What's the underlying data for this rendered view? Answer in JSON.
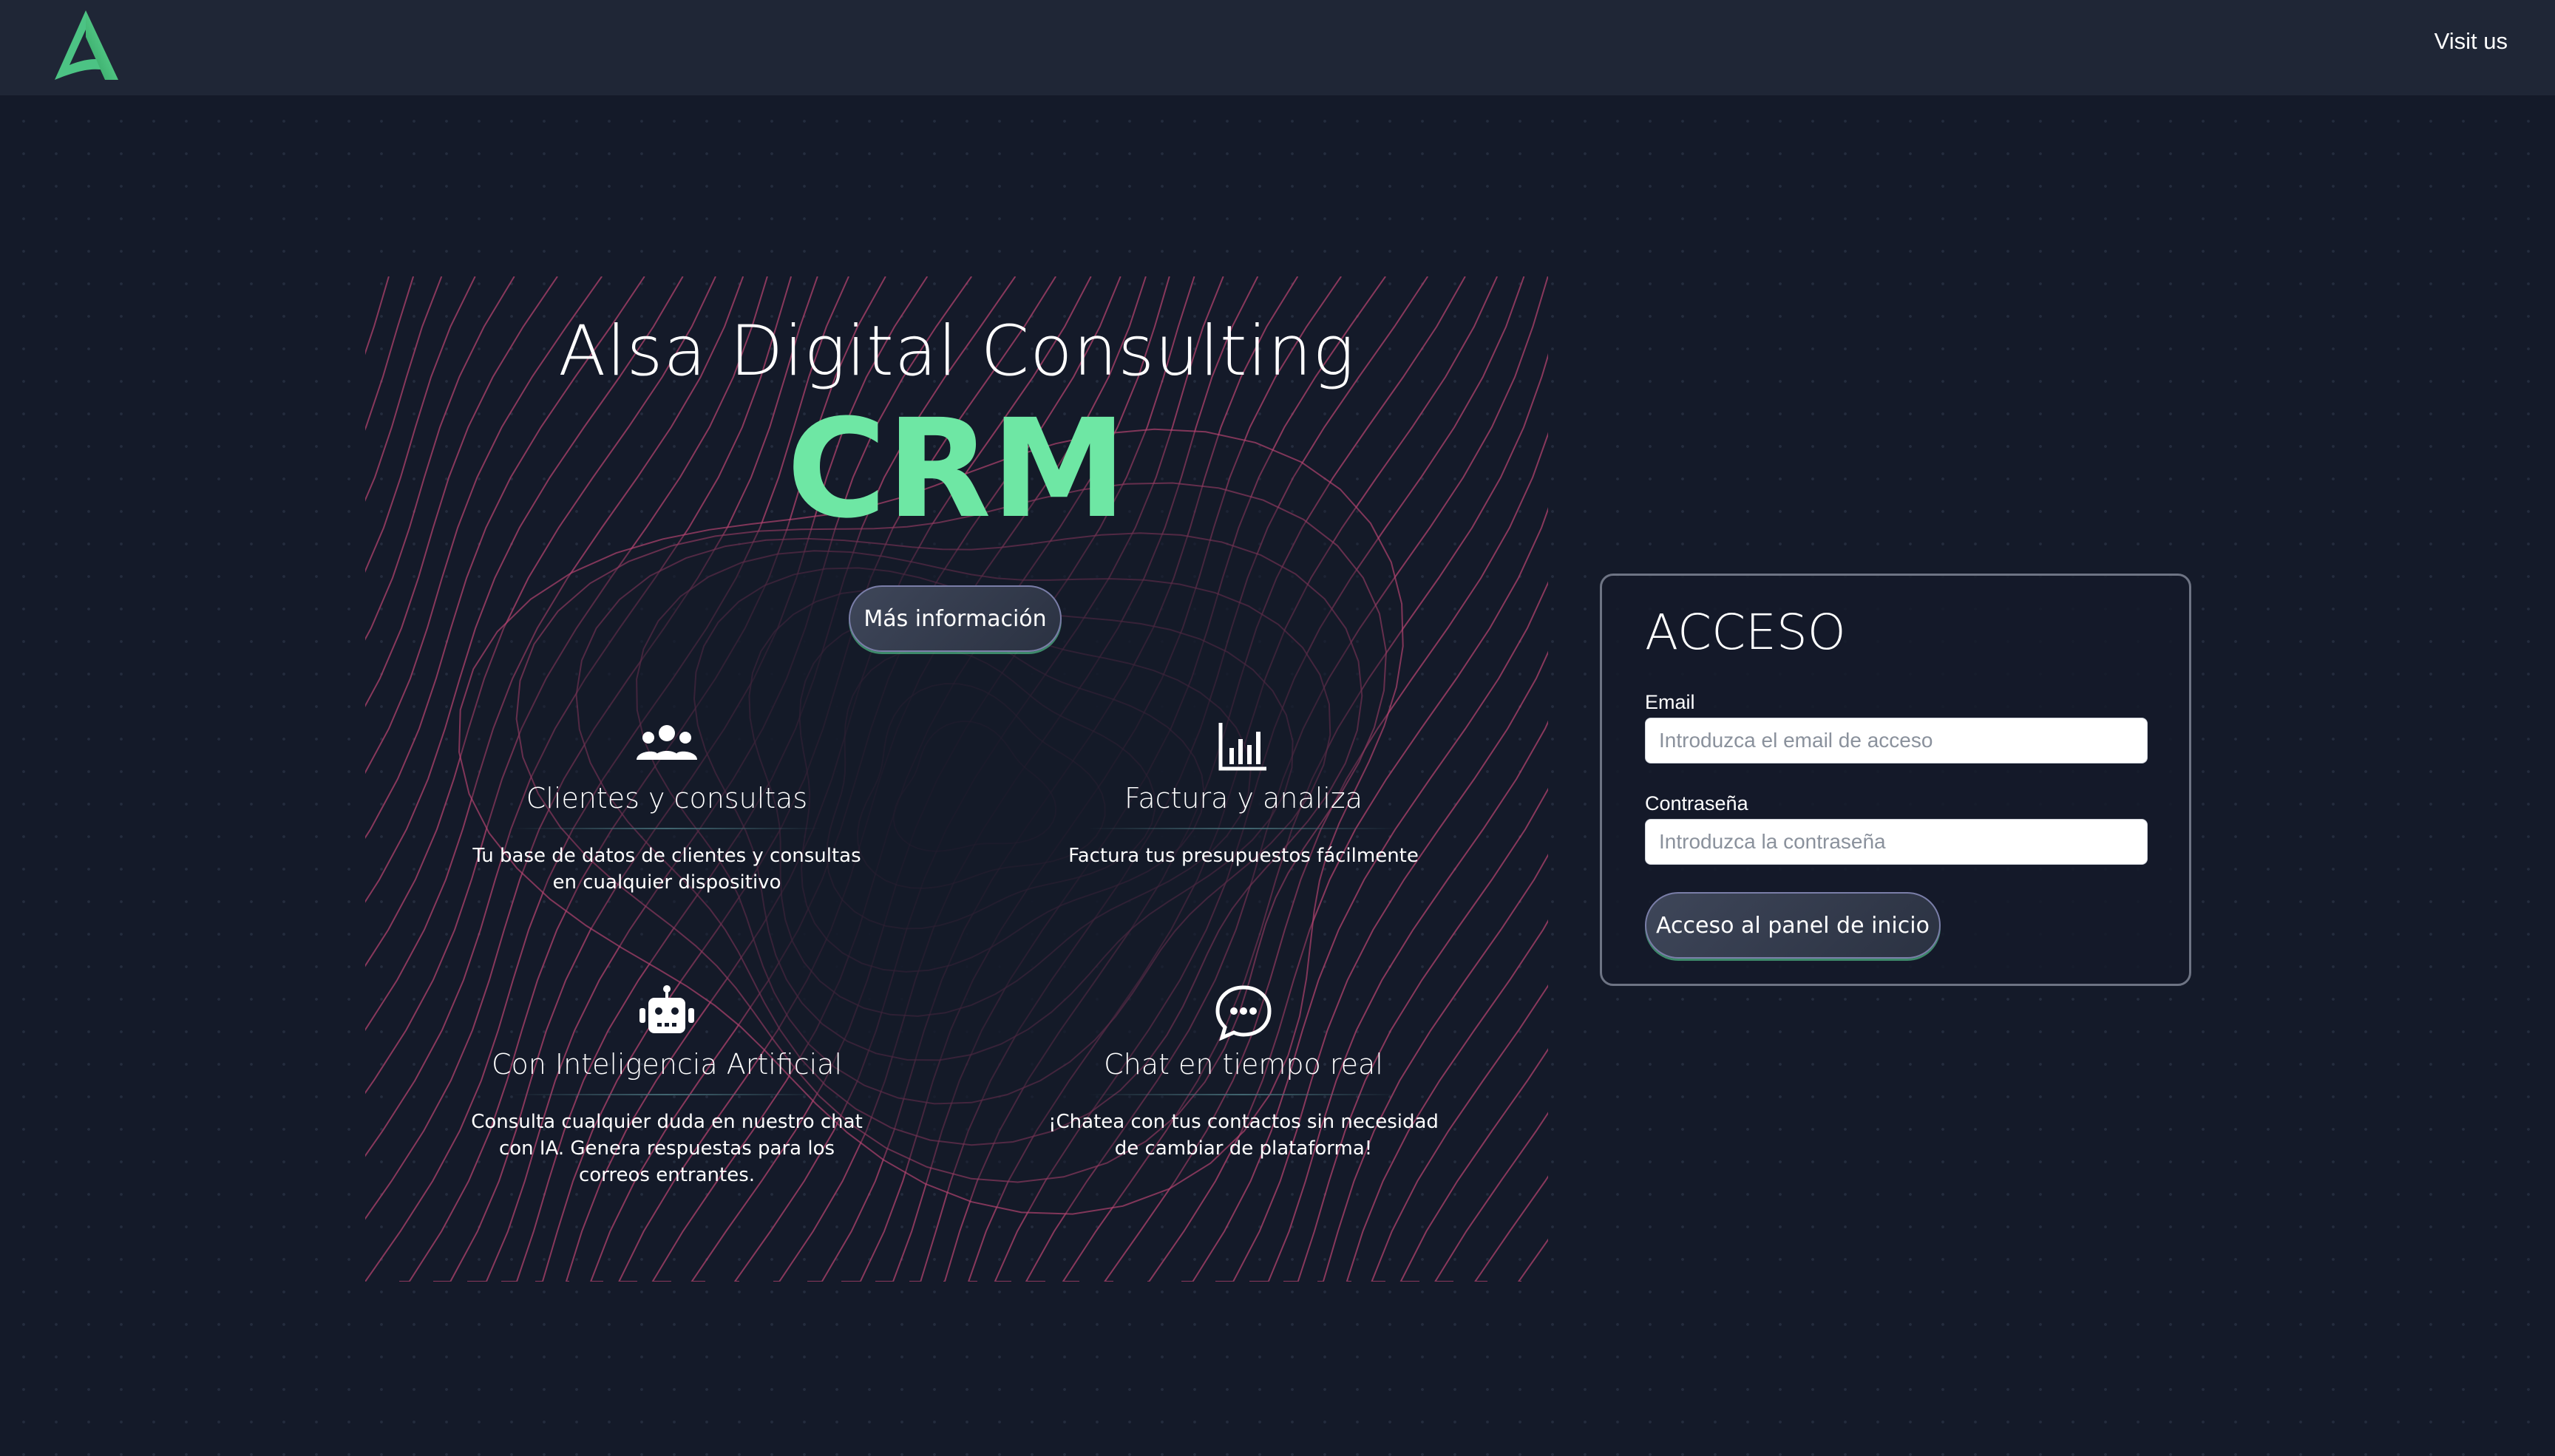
{
  "header": {
    "logo_alt": "",
    "visit_label": "Visit us"
  },
  "hero": {
    "title": "Alsa Digital Consulting",
    "subtitle": "CRM",
    "more_button": "Más información",
    "features": [
      {
        "icon": "users-group-icon",
        "title": "Clientes y consultas",
        "desc": "Tu base de datos de clientes y consultas en cualquier dispositivo"
      },
      {
        "icon": "bar-chart-icon",
        "title": "Factura y analiza",
        "desc": "Factura tus presupuestos fácilmente"
      },
      {
        "icon": "robot-icon",
        "title": "Con Inteligencia Artificial",
        "desc": "Consulta cualquier duda en nuestro chat con IA. Genera respuestas para los correos entrantes."
      },
      {
        "icon": "chat-bubble-icon",
        "title": "Chat en tiempo real",
        "desc": "¡Chatea con tus contactos sin necesidad de cambiar de plataforma!"
      }
    ]
  },
  "login": {
    "title": "ACCESO",
    "email_label": "Email",
    "email_placeholder": "Introduzca el email de acceso",
    "password_label": "Contraseña",
    "password_placeholder": "Introduzca la contraseña",
    "submit_label": "Acceso al panel de inicio"
  },
  "colors": {
    "background": "#141a29",
    "header": "#1f2636",
    "accent_green": "#6ee7a4",
    "pattern_lines": "#b0436e"
  }
}
